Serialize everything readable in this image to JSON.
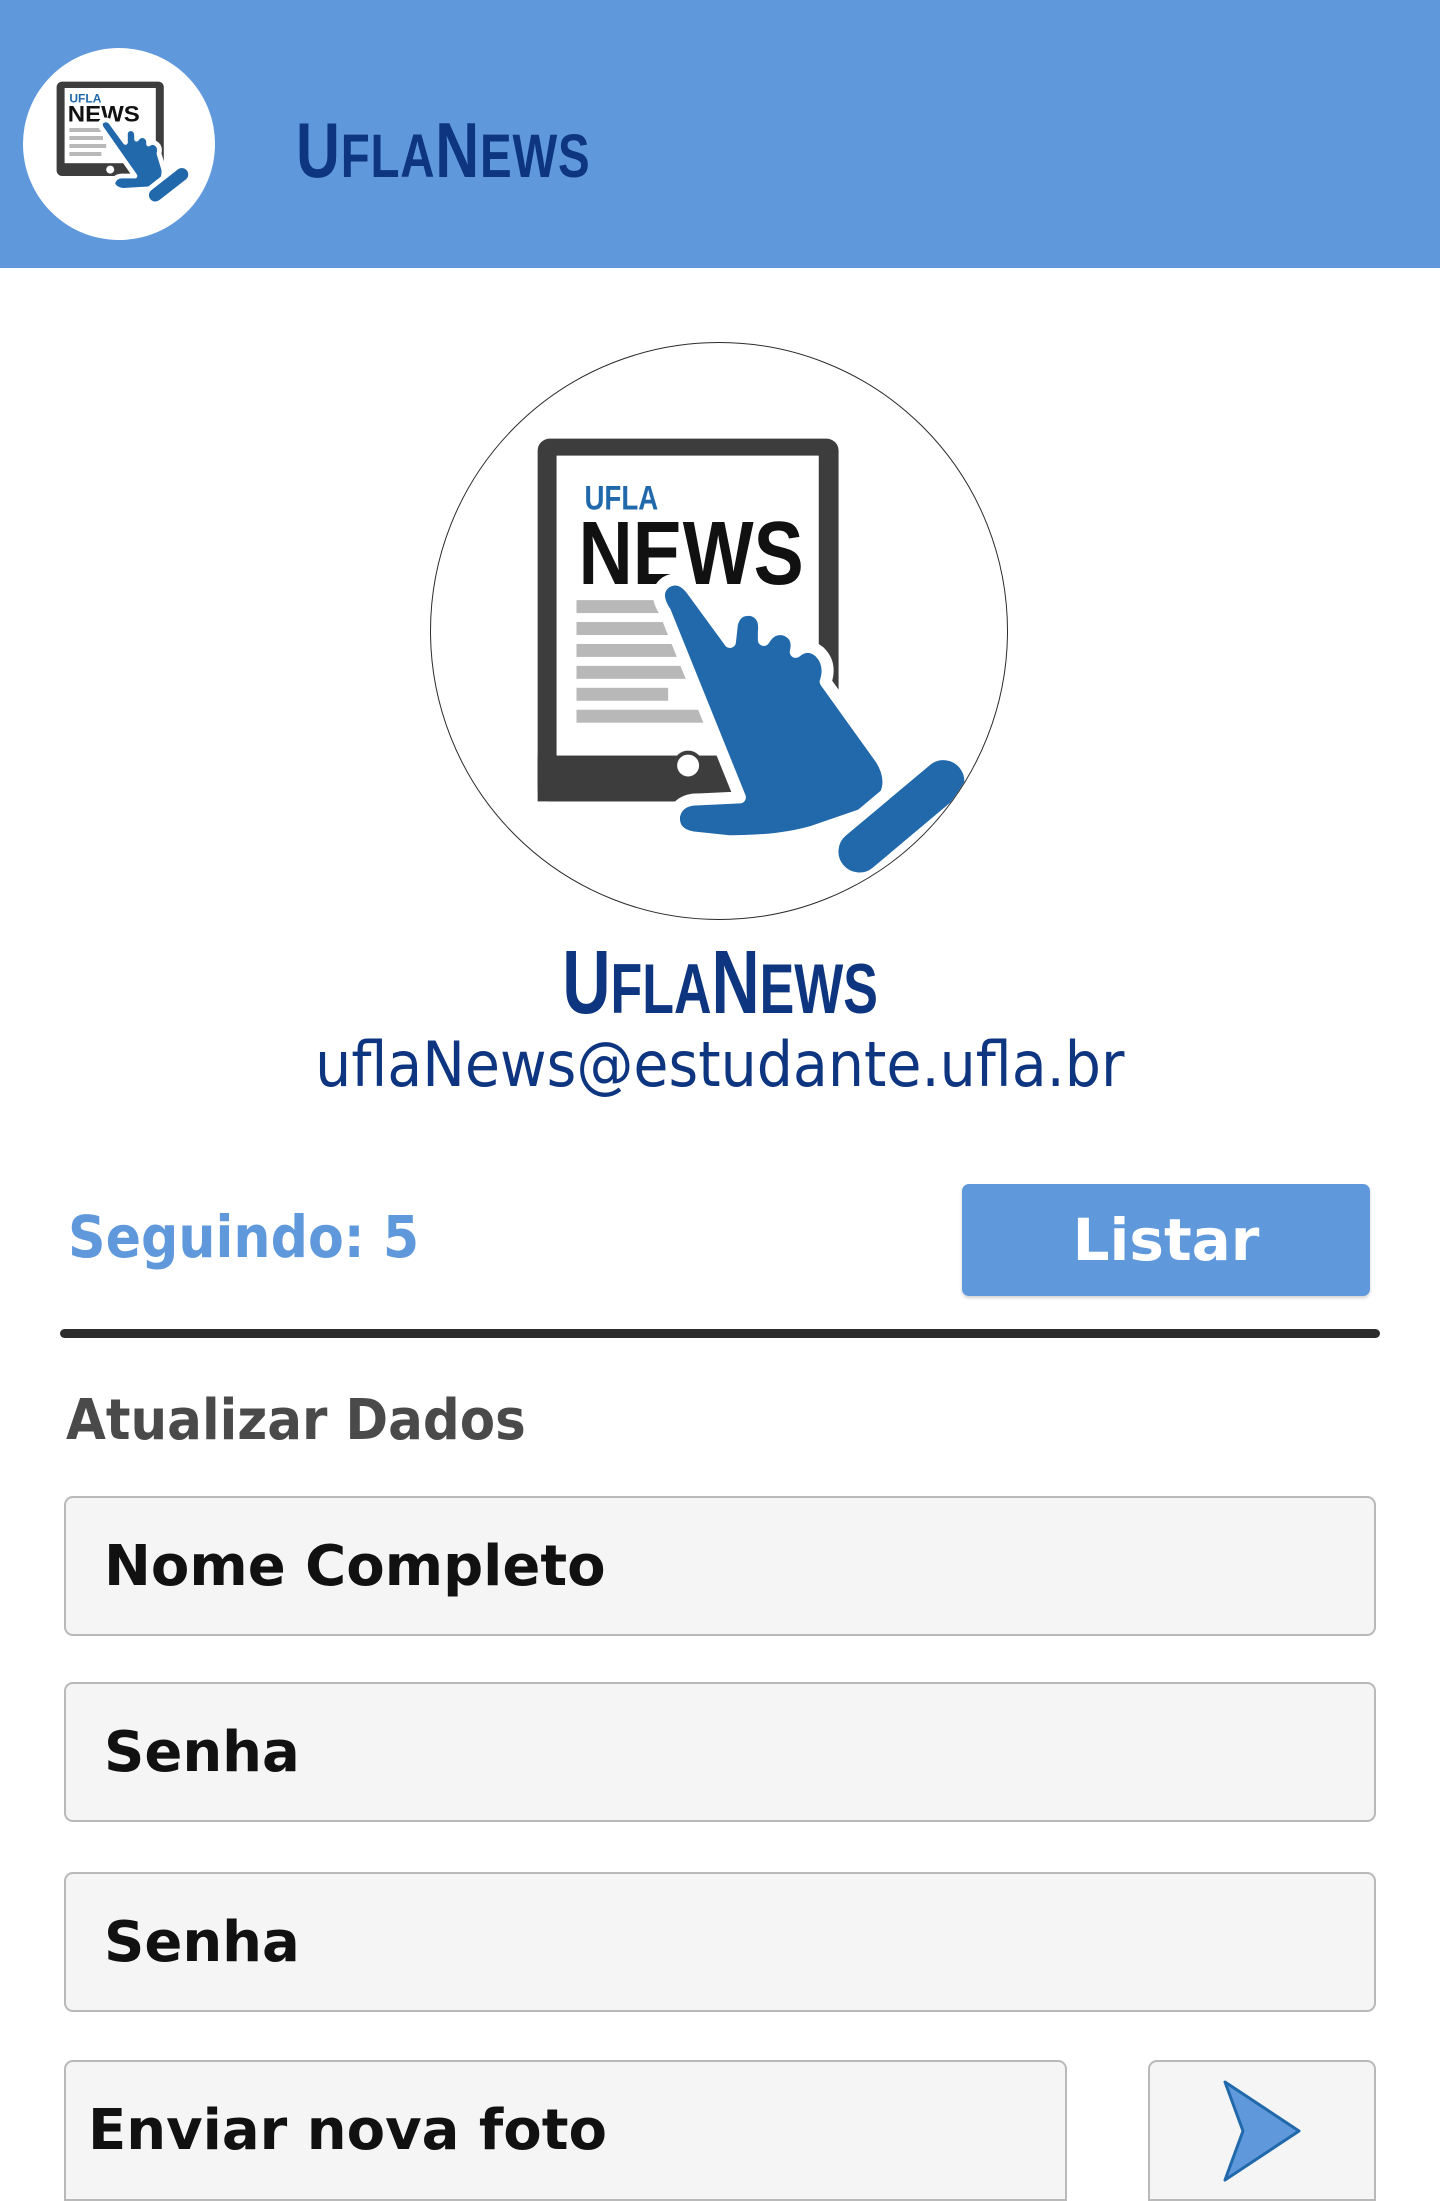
{
  "app_bar": {
    "title_prefix": "U",
    "title_mid": "FLA",
    "title_n": "N",
    "title_suffix": "EWS",
    "logo_icon": "ufla-news-tablet-hand-icon",
    "logo_text_small": "UFLA",
    "logo_text_big": "NEWS"
  },
  "profile": {
    "avatar_icon": "ufla-news-tablet-hand-icon",
    "avatar_text_small": "UFLA",
    "avatar_text_big": "NEWS",
    "name_prefix": "U",
    "name_mid": "FLA",
    "name_n": "N",
    "name_suffix": "EWS",
    "email": "uflaNews@estudante.ufla.br"
  },
  "following": {
    "label": "Seguindo: 5",
    "list_button_label": "Listar"
  },
  "update_form": {
    "title": "Atualizar Dados",
    "full_name_placeholder": "Nome Completo",
    "password_placeholder": "Senha",
    "password_confirm_placeholder": "Senha",
    "photo_placeholder": "Enviar nova foto",
    "send_icon": "play-arrow-icon"
  },
  "colors": {
    "primary": "#5f99dc",
    "navy": "#0e3580",
    "icon_blue": "#2169ab",
    "tablet_dark": "#3d3d3d",
    "field_bg": "#f5f5f5"
  }
}
